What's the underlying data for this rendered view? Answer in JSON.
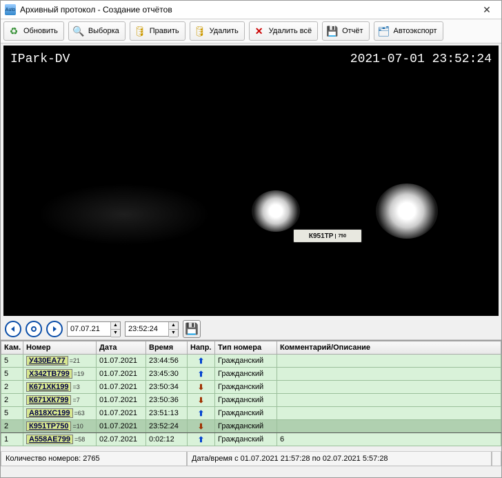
{
  "window": {
    "title": "Архивный протокол - Создание отчётов",
    "icon": "Auto"
  },
  "toolbar": {
    "refresh": "Обновить",
    "filter": "Выборка",
    "edit": "Править",
    "delete": "Удалить",
    "delete_all": "Удалить всё",
    "report": "Отчёт",
    "autoexport": "Автоэкспорт"
  },
  "video": {
    "source_label": "IPark-DV",
    "timestamp": "2021-07-01 23:52:24",
    "plate_main": "К951ТР",
    "plate_region": "750"
  },
  "controls": {
    "date": "07.07.21",
    "time": "23:52:24"
  },
  "table": {
    "headers": {
      "cam": "Кам.",
      "plate": "Номер",
      "date": "Дата",
      "time": "Время",
      "dir": "Напр.",
      "type": "Тип номера",
      "comment": "Комментарий/Описание"
    },
    "rows": [
      {
        "cam": "5",
        "plate": "У430ЕА77",
        "suffix": "=21",
        "date": "01.07.2021",
        "time": "23:44:56",
        "dir": "up",
        "type": "Гражданский",
        "comment": "",
        "selected": false
      },
      {
        "cam": "5",
        "plate": "Х342ТВ799",
        "suffix": "=19",
        "date": "01.07.2021",
        "time": "23:45:30",
        "dir": "up",
        "type": "Гражданский",
        "comment": "",
        "selected": false
      },
      {
        "cam": "2",
        "plate": "К671ХК199",
        "suffix": "=3",
        "date": "01.07.2021",
        "time": "23:50:34",
        "dir": "down",
        "type": "Гражданский",
        "comment": "",
        "selected": false
      },
      {
        "cam": "2",
        "plate": "К671ХК799",
        "suffix": "=7",
        "date": "01.07.2021",
        "time": "23:50:36",
        "dir": "down",
        "type": "Гражданский",
        "comment": "",
        "selected": false
      },
      {
        "cam": "5",
        "plate": "А818ХС199",
        "suffix": "=63",
        "date": "01.07.2021",
        "time": "23:51:13",
        "dir": "up",
        "type": "Гражданский",
        "comment": "",
        "selected": false
      },
      {
        "cam": "2",
        "plate": "К951ТР750",
        "suffix": "=10",
        "date": "01.07.2021",
        "time": "23:52:24",
        "dir": "down",
        "type": "Гражданский",
        "comment": "",
        "selected": true
      },
      {
        "cam": "1",
        "plate": "А558АЕ799",
        "suffix": "=58",
        "date": "02.07.2021",
        "time": "0:02:12",
        "dir": "up",
        "type": "Гражданский",
        "comment": "6",
        "selected": false
      }
    ]
  },
  "status": {
    "count": "Количество номеров: 2765",
    "range": "Дата/время с 01.07.2021 21:57:28 по 02.07.2021 5:57:28"
  }
}
